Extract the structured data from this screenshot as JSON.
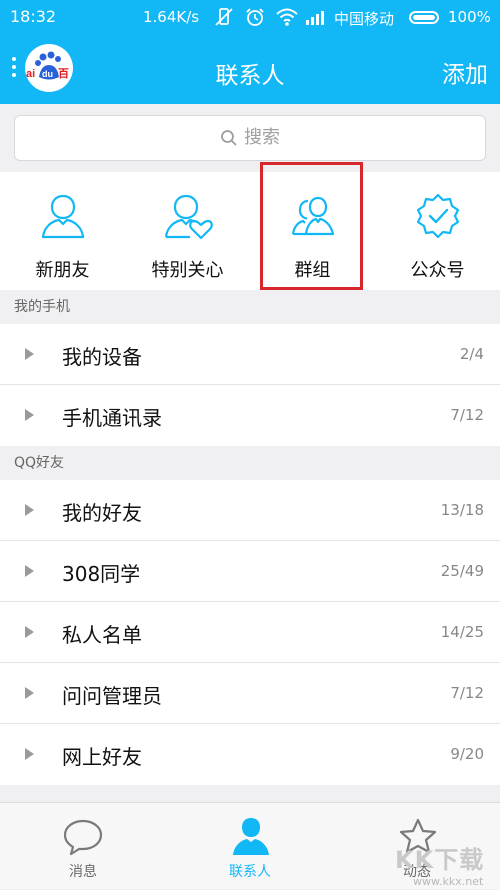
{
  "status_bar": {
    "time": "18:32",
    "speed": "1.64K/s",
    "carrier": "中国移动",
    "battery": "100%"
  },
  "header": {
    "avatar_text": "Bai du 百",
    "title": "联系人",
    "add_label": "添加"
  },
  "search": {
    "placeholder": "搜索"
  },
  "quick_actions": [
    {
      "label": "新朋友",
      "icon": "person-icon"
    },
    {
      "label": "特别关心",
      "icon": "person-heart-icon"
    },
    {
      "label": "群组",
      "icon": "group-icon"
    },
    {
      "label": "公众号",
      "icon": "verified-badge-icon"
    }
  ],
  "highlight_color": "#d6272d",
  "accent_color": "#12b7f5",
  "sections": [
    {
      "title": "我的手机",
      "rows": [
        {
          "name": "我的设备",
          "count": "2/4"
        },
        {
          "name": "手机通讯录",
          "count": "7/12"
        }
      ]
    },
    {
      "title": "QQ好友",
      "rows": [
        {
          "name": "我的好友",
          "count": "13/18"
        },
        {
          "name": "308同学",
          "count": "25/49"
        },
        {
          "name": "私人名单",
          "count": "14/25"
        },
        {
          "name": "问问管理员",
          "count": "7/12"
        },
        {
          "name": "网上好友",
          "count": "9/20"
        }
      ]
    }
  ],
  "tabs": [
    {
      "label": "消息",
      "icon": "chat-bubble-icon"
    },
    {
      "label": "联系人",
      "icon": "contact-person-icon",
      "active": true
    },
    {
      "label": "动态",
      "icon": "star-icon"
    }
  ],
  "watermark": {
    "text": "KK下载",
    "url": "www.kkx.net"
  }
}
